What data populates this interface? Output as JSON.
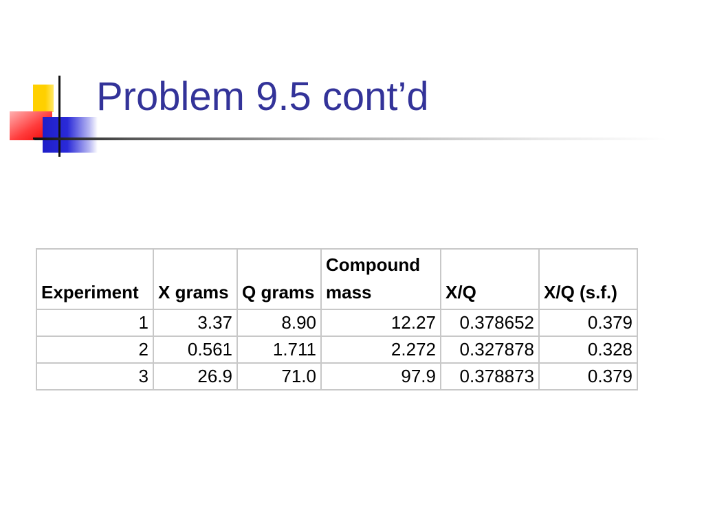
{
  "slide": {
    "title": "Problem 9.5 cont’d"
  },
  "table": {
    "headers": [
      "Experiment",
      "X grams",
      "Q grams",
      "Compound mass",
      "X/Q",
      "X/Q (s.f.)"
    ],
    "rows": [
      [
        "1",
        "3.37",
        "8.90",
        "12.27",
        "0.378652",
        "0.379"
      ],
      [
        "2",
        "0.561",
        "1.711",
        "2.272",
        "0.327878",
        "0.328"
      ],
      [
        "3",
        "26.9",
        "71.0",
        "97.9",
        "0.378873",
        "0.379"
      ]
    ]
  },
  "colors": {
    "title": "#333399",
    "logo_yellow": "#ffd000",
    "logo_red": "#ff3b3b",
    "logo_blue": "#2a2ad8",
    "table_border": "#c8c8c8"
  }
}
